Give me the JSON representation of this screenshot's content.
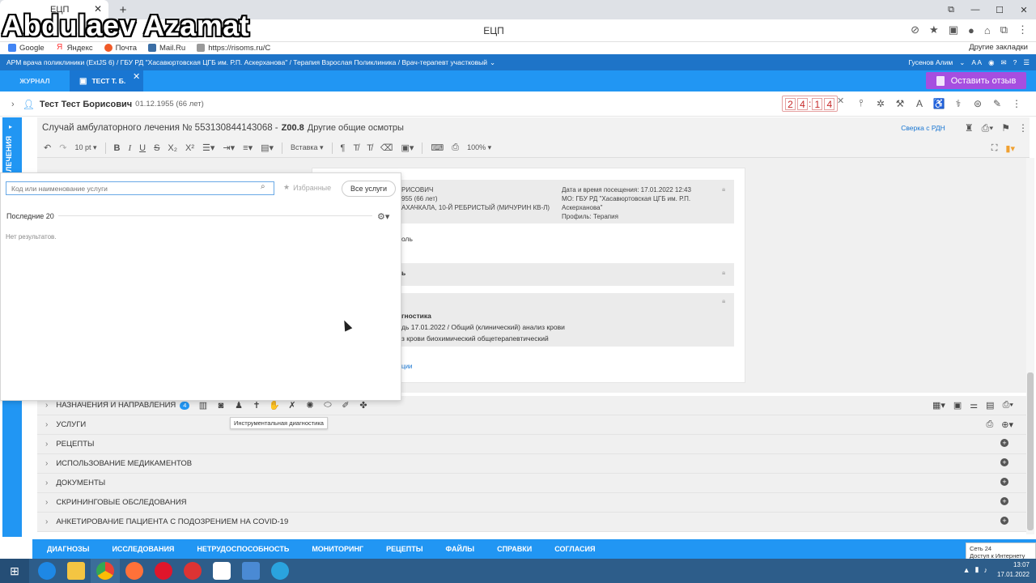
{
  "browser": {
    "tab_title": "ЕЦП",
    "window_title": "ЕЦП",
    "bookmarks": [
      "Google",
      "Яндекс",
      "Почта",
      "Mail.Ru",
      "https://risoms.ru/C"
    ],
    "other_bookmarks": "Другие закладки",
    "win_controls": [
      "⧉",
      "—",
      "☐",
      "✕"
    ],
    "addr_icons": [
      "⊘",
      "★",
      "▣",
      "●",
      "⌂",
      "⧉",
      "⋮"
    ]
  },
  "overlay": {
    "watermark": "Abdulaev Azamat"
  },
  "app": {
    "breadcrumb": "АРМ врача поликлиники (ExtJS 6) / ГБУ РД \"Хасавюртовская ЦГБ им. Р.П. Аскерханова\" / Терапия Взрослая Поликлиника / Врач-терапевт участковый",
    "user": "Гусенов Алим",
    "font_ctrl": "A A",
    "tabs": [
      {
        "label": "ЖУРНАЛ"
      },
      {
        "label": "ТЕСТ Т. Б."
      }
    ],
    "feedback_label": "Оставить отзыв"
  },
  "patient": {
    "name": "Тест Тест Борисович",
    "dob": "01.12.1955 (66 лет)",
    "timer_digits": [
      "2",
      "4",
      "1",
      "4"
    ],
    "tools": [
      "⫯",
      "✲",
      "⚒",
      "A",
      "♿",
      "⚕",
      "⊜",
      "✎",
      "⋮"
    ]
  },
  "left_strip": {
    "label": "ЛЕЧЕНИЯ"
  },
  "case": {
    "title": "Случай амбулаторного лечения № 553130844143068 -",
    "code": "Z00.8",
    "diagnosis": "Другие общие осмотры",
    "sverka": "Сверка с РДН"
  },
  "editor": {
    "font_size": "10 pt",
    "insert": "Вставка",
    "zoom": "100%"
  },
  "document": {
    "patient_partial": "РИСОВИЧ",
    "dob_partial": "955 (66 лет)",
    "address_partial": "АХАЧКАЛА, 10-Й РЕБРИСТЫЙ (МИЧУРИН КВ-Л)",
    "visit_datetime": "Дата и время посещения: 17.01.2022 12:43",
    "mo_line1": "МО: ГБУ РД \"Хасавюртовская ЦГБ им. Р.П.",
    "mo_line2": "Аскерханова\"",
    "profile": "Профиль: Терапия",
    "text_partial1": "оль",
    "text_partial2": "ь",
    "diag_heading_partial": "гностика",
    "diag_line1": "дь 17.01.2022 / Общий (клинический) анализ крови",
    "diag_line2": "з крови биохимический общетерапевтический",
    "link_partial": "ции"
  },
  "services_popup": {
    "search_placeholder": "Код или наименование услуги",
    "favorites": "Избранные",
    "all_services": "Все услуги",
    "recent_label": "Последние 20",
    "no_results": "Нет результатов."
  },
  "sections": [
    {
      "label": "НАЗНАЧЕНИЯ И НАПРАВЛЕНИЯ",
      "badge": "4"
    },
    {
      "label": "УСЛУГИ"
    },
    {
      "label": "РЕЦЕПТЫ"
    },
    {
      "label": "ИСПОЛЬЗОВАНИЕ МЕДИКАМЕНТОВ"
    },
    {
      "label": "ДОКУМЕНТЫ"
    },
    {
      "label": "СКРИНИНГОВЫЕ ОБСЛЕДОВАНИЯ"
    },
    {
      "label": "АНКЕТИРОВАНИЕ ПАЦИЕНТА С ПОДОЗРЕНИЕМ НА COVID-19"
    }
  ],
  "tooltip": "Инструментальная диагностика",
  "bottom_nav": [
    "ДИАГНОЗЫ",
    "ИССЛЕДОВАНИЯ",
    "НЕТРУДОСПОСОБНОСТЬ",
    "МОНИТОРИНГ",
    "РЕЦЕПТЫ",
    "ФАЙЛЫ",
    "СПРАВКИ",
    "СОГЛАСИЯ"
  ],
  "network": {
    "line1": "Сеть  24",
    "line2": "Доступ к Интернету"
  },
  "taskbar": {
    "time": "13:07",
    "date": "17.01.2022"
  },
  "colors": {
    "app_blue": "#2196f3",
    "header_blue": "#1e74c8",
    "feedback_purple": "#a64ee0",
    "timer_red": "#c62828"
  }
}
